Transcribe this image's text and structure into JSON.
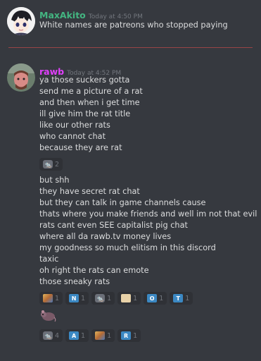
{
  "messages": [
    {
      "username": "MaxAkito",
      "username_color": "#43b581",
      "timestamp": "Today at 4:50 PM",
      "lines": [
        "White names are patreons who stopped paying"
      ]
    },
    {
      "username": "rawb",
      "username_color": "#e040fb",
      "timestamp": "Today at 4:52 PM",
      "lines": [
        "ya those suckers gotta",
        "send me a picture of a rat",
        "and then when i get time",
        "ill give him the rat title",
        "like our other rats",
        "who cannot chat",
        "because they are rat"
      ],
      "reactions_1": [
        {
          "icon": "rat-emote-icon",
          "count": "2"
        }
      ],
      "lines_2": [
        "but shh",
        "they have secret rat chat",
        "but they can talk in game channels cause",
        "thats where you make friends and well im not that evil",
        "rats cant even SEE capitalist pig chat",
        "where all da rawb.tv money lives",
        "my goodness so much elitism in this discord",
        "taxic",
        "oh right the rats can emote",
        "those sneaky rats"
      ],
      "reactions_2": [
        {
          "icon": "mixed-emote-icon",
          "count": "1"
        },
        {
          "icon": "regional-n-icon",
          "letter": "N",
          "count": "1"
        },
        {
          "icon": "rat-emote-icon",
          "count": "1"
        },
        {
          "icon": "document-emote-icon",
          "count": "1"
        },
        {
          "icon": "regional-o-icon",
          "letter": "O",
          "count": "1"
        },
        {
          "icon": "regional-t-icon",
          "letter": "T",
          "count": "1"
        }
      ],
      "reactions_3": [
        {
          "icon": "rat-emote-icon",
          "count": "4"
        },
        {
          "icon": "regional-a-icon",
          "letter": "A",
          "count": "1"
        },
        {
          "icon": "mixed-emote-icon",
          "count": "1"
        },
        {
          "icon": "regional-r-icon",
          "letter": "R",
          "count": "1"
        }
      ]
    }
  ],
  "colors": {
    "background": "#36393f",
    "divider": "#b9484a",
    "reaction_bg": "#2f3136",
    "regional_indicator": "#3b88c3"
  }
}
